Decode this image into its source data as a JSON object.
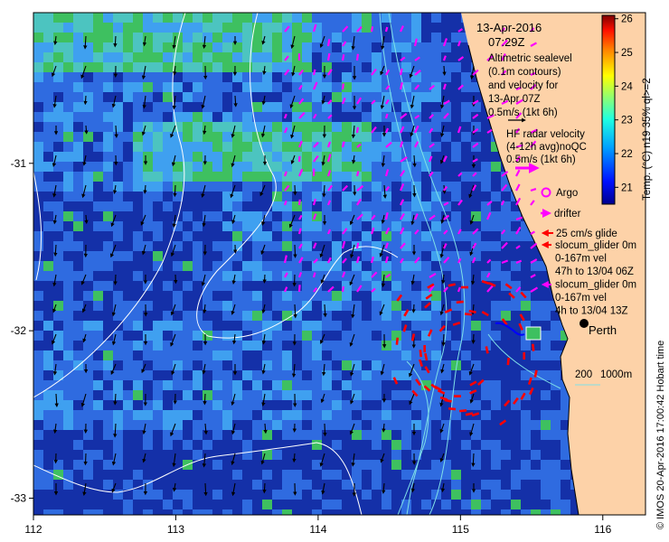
{
  "map": {
    "lon_range": [
      112,
      116.3
    ],
    "lat_range": [
      -33.1,
      -30.1
    ],
    "x_ticks": [
      "112",
      "113",
      "114",
      "115",
      "116"
    ],
    "y_ticks": [
      "-31",
      "-32",
      "-33"
    ],
    "colors": {
      "ocean_deep": "#1430a8",
      "ocean_mid": "#2f6be0",
      "ocean_light": "#3fa0f0",
      "ocean_warm": "#4cc4c0",
      "ocean_green": "#3ec060",
      "land": "#fdd2a8",
      "contour": "#ffffff",
      "bathymetry": "#7fe0e8",
      "radar_vector": "#ff00ff",
      "glider_vector": "#ff0000",
      "glider_track": "#0000ff",
      "argo": "#ff00ff"
    }
  },
  "annotation": {
    "date": "13-Apr-2016",
    "time": "07:29Z",
    "altimetry_lines": [
      "Altimetric sealevel",
      "(0.1m contours)",
      "and velocity for",
      "13-Apr 07Z",
      "0.5m/s (1kt 6h)"
    ],
    "radar_lines": [
      "HF radar velocity",
      "(4-12h avg)noQC",
      "0.5m/s (1kt 6h)"
    ]
  },
  "legend": {
    "argo_label": "Argo",
    "drifter_label": "drifter",
    "glide_label": "25 cm/s glide",
    "glider_lines": [
      "slocum_glider 0m",
      "0-167m vel",
      "47h to 13/04 06Z",
      "slocum_glider 0m",
      "0-167m vel",
      "4h to 13/04 13Z"
    ]
  },
  "city": {
    "name": "Perth"
  },
  "scale": {
    "label_200": "200",
    "label_1000": "1000m"
  },
  "colorbar": {
    "ticks": [
      "26",
      "25",
      "24",
      "23",
      "22",
      "21"
    ],
    "title": "Temp. (°C) n19 35% ql>=2"
  },
  "credit": "© IMOS 20-Apr-2016 17:00:42 Hobart time"
}
